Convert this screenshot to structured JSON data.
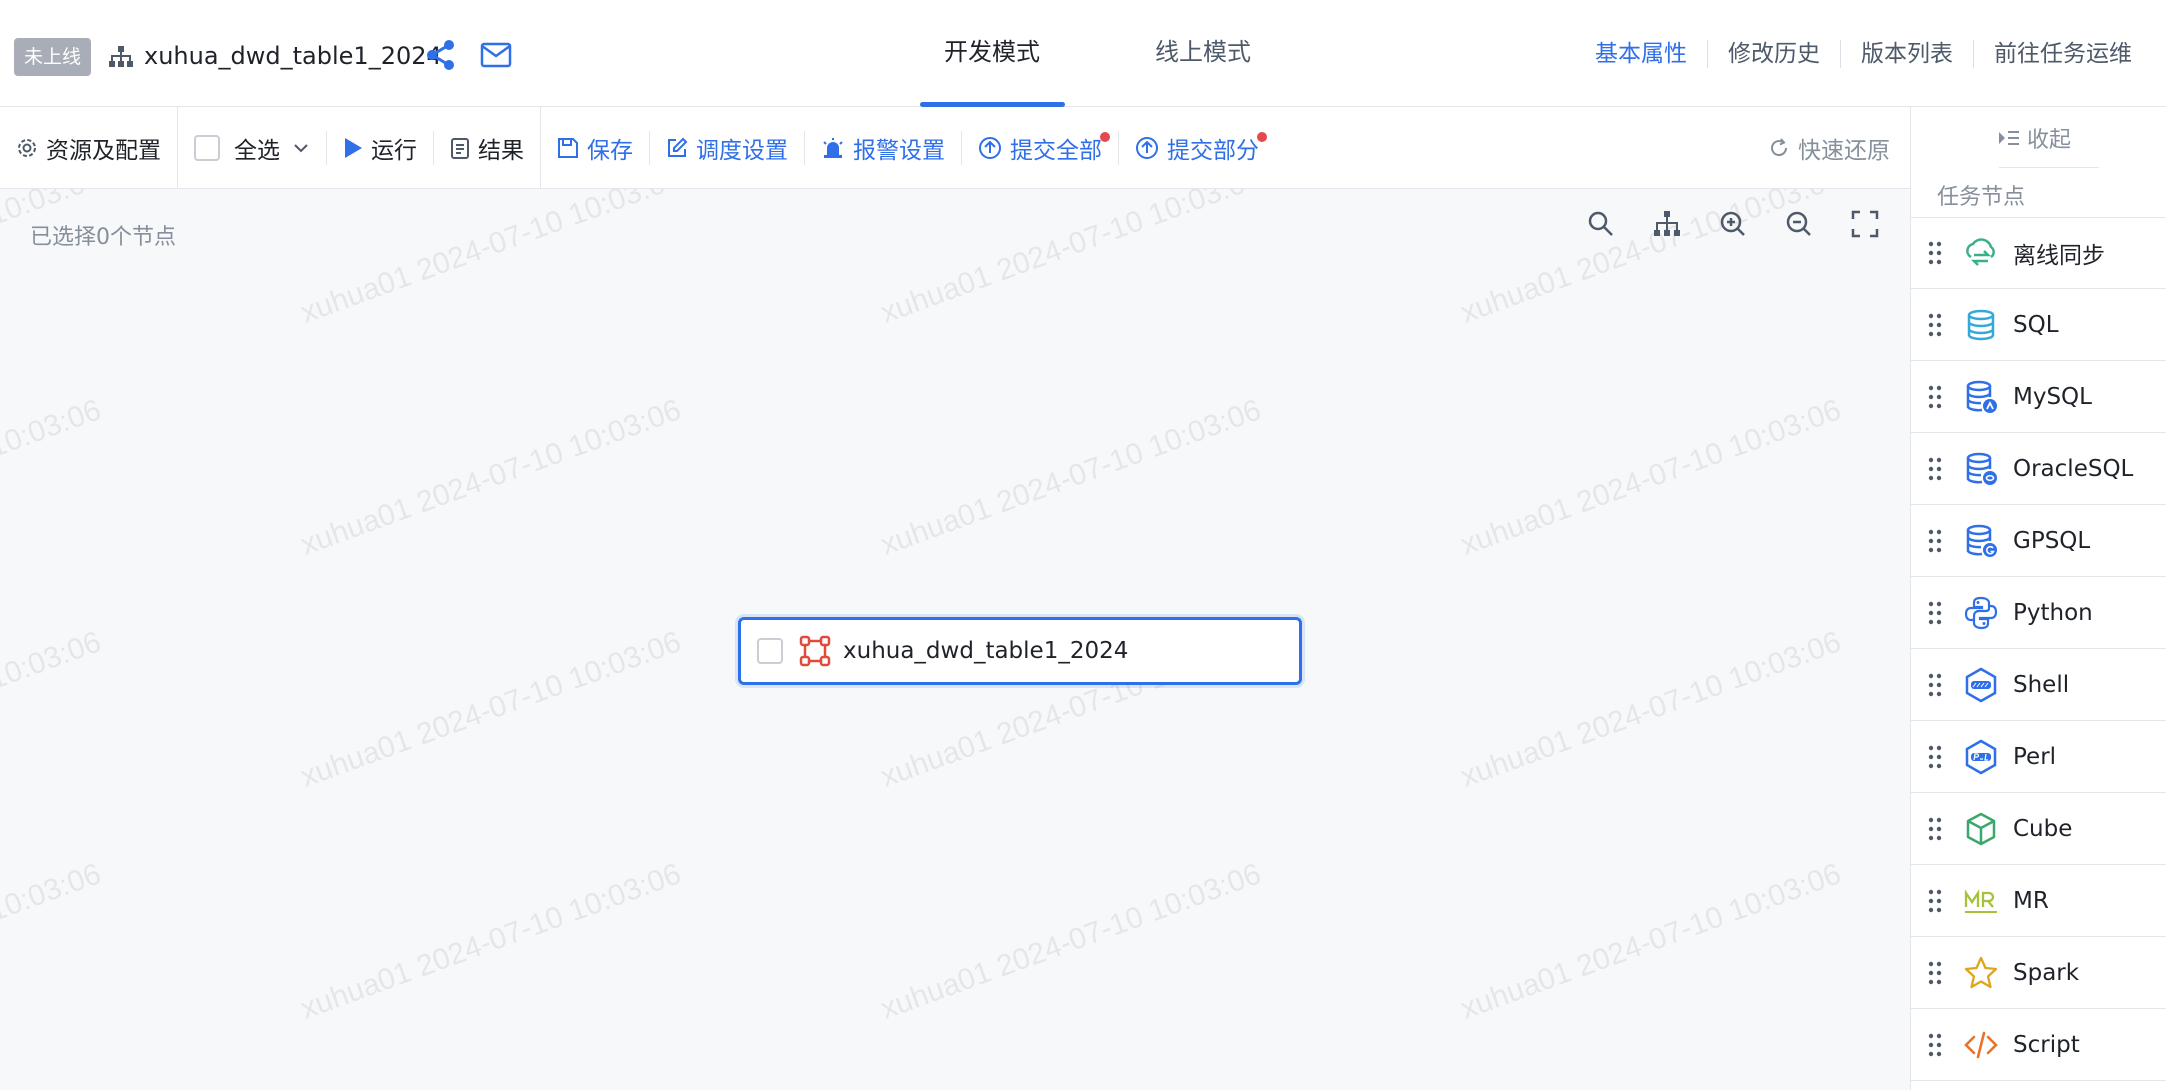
{
  "header": {
    "status_badge": "未上线",
    "task_name": "xuhua_dwd_table1_2024",
    "modes": [
      {
        "label": "开发模式",
        "active": true
      },
      {
        "label": "线上模式",
        "active": false
      }
    ],
    "links": [
      {
        "label": "基本属性",
        "active": true
      },
      {
        "label": "修改历史",
        "active": false
      },
      {
        "label": "版本列表",
        "active": false
      },
      {
        "label": "前往任务运维",
        "active": false
      }
    ]
  },
  "toolbar": {
    "resources": "资源及配置",
    "select_all": "全选",
    "run": "运行",
    "result": "结果",
    "save": "保存",
    "schedule": "调度设置",
    "alarm": "报警设置",
    "submit_all": "提交全部",
    "submit_part": "提交部分",
    "quick_restore": "快速还原"
  },
  "canvas": {
    "selected_count": "已选择0个节点",
    "node_label": "xuhua_dwd_table1_2024",
    "watermark": "xuhua01 2024-07-10 10:03:06"
  },
  "panel": {
    "collapse": "收起",
    "section_title": "任务节点",
    "node_types": [
      {
        "label": "离线同步",
        "icon": "cloud-sync-icon"
      },
      {
        "label": "SQL",
        "icon": "database-icon"
      },
      {
        "label": "MySQL",
        "icon": "mysql-icon"
      },
      {
        "label": "OracleSQL",
        "icon": "oracle-icon"
      },
      {
        "label": "GPSQL",
        "icon": "gpsql-icon"
      },
      {
        "label": "Python",
        "icon": "python-icon"
      },
      {
        "label": "Shell",
        "icon": "shell-icon"
      },
      {
        "label": "Perl",
        "icon": "perl-icon"
      },
      {
        "label": "Cube",
        "icon": "cube-icon"
      },
      {
        "label": "MR",
        "icon": "mr-icon"
      },
      {
        "label": "Spark",
        "icon": "star-icon"
      },
      {
        "label": "Script",
        "icon": "code-icon"
      }
    ]
  },
  "colors": {
    "accent": "#2f6fe8",
    "badge_bg": "#a8adb7",
    "alert_dot": "#e5484d",
    "canvas_bg": "#f7f8fa"
  }
}
